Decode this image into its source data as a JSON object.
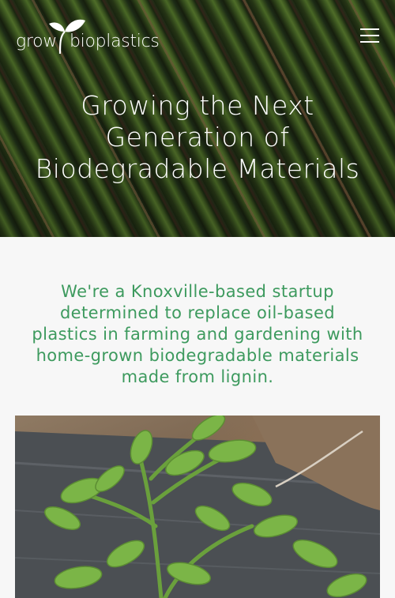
{
  "header": {
    "logo": {
      "word1": "grow",
      "word2": "bioplastics"
    },
    "menu_icon": "hamburger-menu-icon"
  },
  "hero": {
    "title_lines": [
      "Growing the Next",
      "Generation of",
      "Biodegradable Materials"
    ]
  },
  "intro": {
    "lines": [
      "We're a Knoxville-based startup",
      "determined to replace oil-based",
      "plastics in farming and gardening with",
      "home-grown biodegradable materials",
      "made from lignin."
    ]
  },
  "colors": {
    "accent_green": "#3d9a5e",
    "hero_text": "#ffffff",
    "page_background": "#f7f7f7"
  },
  "photo": {
    "subject": "tomato-seedling-on-plastic-mulch"
  }
}
